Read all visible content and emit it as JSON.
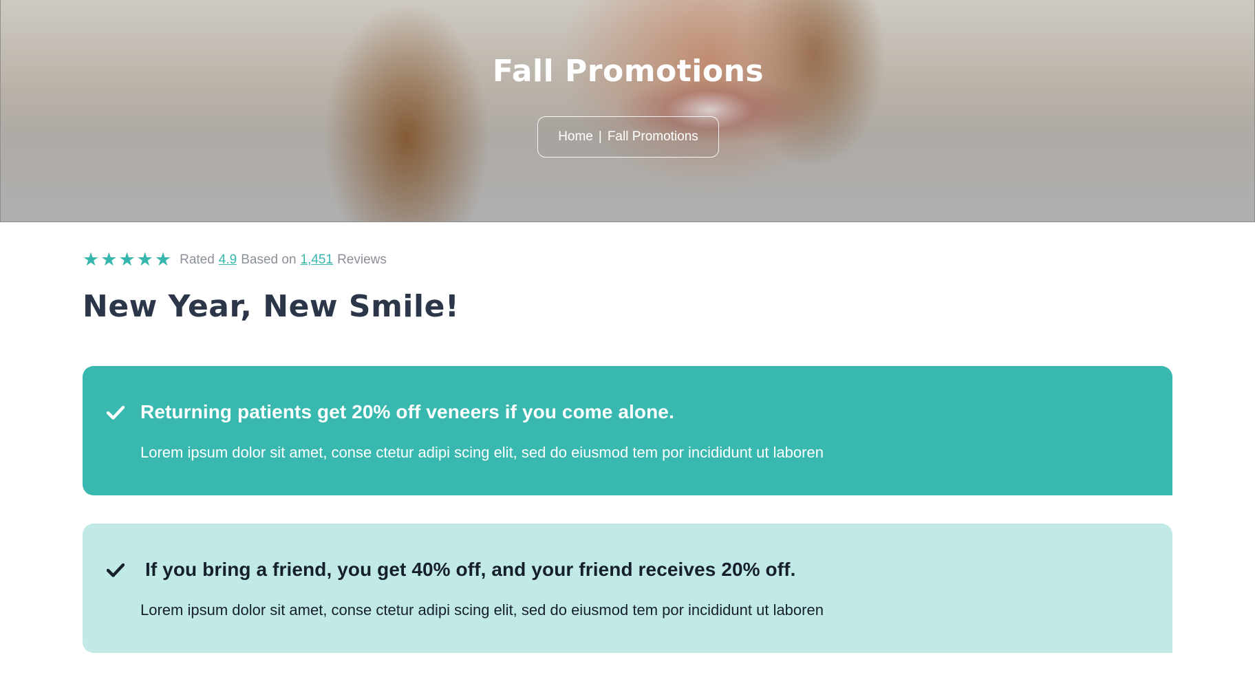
{
  "hero": {
    "title": "Fall Promotions",
    "breadcrumb": {
      "home": "Home",
      "separator": "|",
      "current": "Fall Promotions"
    }
  },
  "rating": {
    "stars": 5,
    "prefix": "Rated",
    "score": "4.9",
    "middle": "Based on",
    "count": "1,451",
    "suffix": "Reviews",
    "star_color": "#36b6ad"
  },
  "page_title": "New Year, New Smile!",
  "promotions": [
    {
      "icon": "check-icon",
      "headline": "Returning patients get 20% off veneers if you come alone.",
      "body": "Lorem ipsum dolor sit amet, conse ctetur adipi scing elit, sed do eiusmod tem por incididunt ut laboren",
      "background": "#38b8ae"
    },
    {
      "icon": "check-icon",
      "headline": "If you bring a friend, you get 40% off, and your friend receives 20% off.",
      "body": "Lorem ipsum dolor sit amet, conse ctetur adipi scing elit, sed do eiusmod tem por incididunt ut laboren",
      "background": "#c1e9e6"
    }
  ]
}
